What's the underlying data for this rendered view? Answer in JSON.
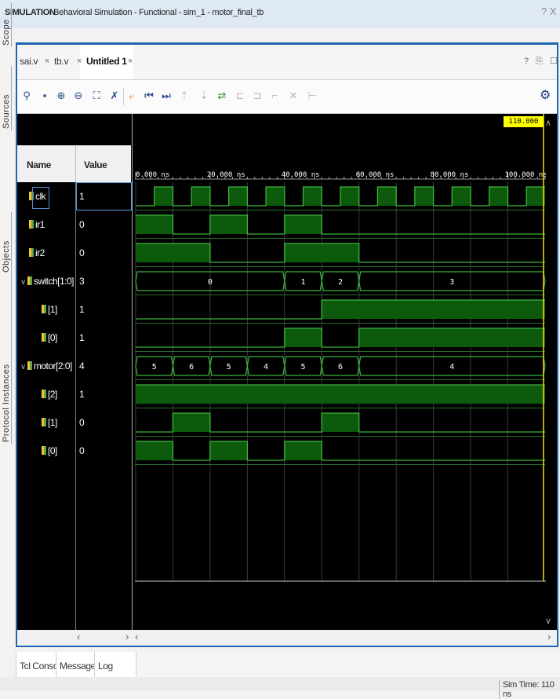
{
  "title": {
    "bold": "SIMULATION",
    "rest": " - Behavioral Simulation - Functional - sim_1 - motor_final_tb",
    "help": "? X"
  },
  "side_tabs": [
    "Scope",
    "Sources",
    "Objects",
    "Protocol Instances"
  ],
  "editor_tabs": [
    {
      "label": "sai.v",
      "close": "×"
    },
    {
      "label": "tb.v",
      "close": "×"
    },
    {
      "label": "Untitled 1",
      "close": "×"
    }
  ],
  "window_controls": "? ⎘ ☐",
  "toolbar_icons": [
    "search-icon",
    "save-icon",
    "zoom-in-icon",
    "zoom-out-icon",
    "zoom-fit-icon",
    "marker-icon",
    "cursor-icon",
    "go-first-icon",
    "go-last-icon",
    "add-marker-icon",
    "prev-marker-icon",
    "next-marker-icon",
    "swap-cursor-icon",
    "prev-transition-icon",
    "next-transition-icon",
    "delete-icon",
    "snap-icon",
    "settings-icon"
  ],
  "headers": {
    "name": "Name",
    "value": "Value"
  },
  "cursor_time": "110.000 ns",
  "time_axis": {
    "unit": "ns",
    "labels": [
      "0.000 ns",
      "20.000 ns",
      "40.000 ns",
      "60.000 ns",
      "80.000 ns",
      "100.000 ns"
    ],
    "label_times": [
      0,
      20,
      40,
      60,
      80,
      100
    ],
    "end": 110
  },
  "signals": [
    {
      "name": "clk",
      "value": "1",
      "type": "bit",
      "transitions": [
        [
          0,
          0
        ],
        [
          5,
          1
        ],
        [
          10,
          0
        ],
        [
          15,
          1
        ],
        [
          20,
          0
        ],
        [
          25,
          1
        ],
        [
          30,
          0
        ],
        [
          35,
          1
        ],
        [
          40,
          0
        ],
        [
          45,
          1
        ],
        [
          50,
          0
        ],
        [
          55,
          1
        ],
        [
          60,
          0
        ],
        [
          65,
          1
        ],
        [
          70,
          0
        ],
        [
          75,
          1
        ],
        [
          80,
          0
        ],
        [
          85,
          1
        ],
        [
          90,
          0
        ],
        [
          95,
          1
        ],
        [
          100,
          0
        ],
        [
          105,
          1
        ]
      ]
    },
    {
      "name": "ir1",
      "value": "0",
      "type": "bit",
      "transitions": [
        [
          0,
          1
        ],
        [
          10,
          0
        ],
        [
          20,
          1
        ],
        [
          30,
          0
        ],
        [
          40,
          1
        ],
        [
          50,
          0
        ]
      ]
    },
    {
      "name": "ir2",
      "value": "0",
      "type": "bit",
      "transitions": [
        [
          0,
          1
        ],
        [
          20,
          0
        ],
        [
          40,
          1
        ],
        [
          60,
          0
        ]
      ]
    },
    {
      "name": "switch[1:0]",
      "value": "3",
      "type": "bus",
      "expandable": true,
      "segments": [
        [
          0,
          40,
          "0"
        ],
        [
          40,
          50,
          "1"
        ],
        [
          50,
          60,
          "2"
        ],
        [
          60,
          110,
          "3"
        ]
      ]
    },
    {
      "name": "[1]",
      "value": "1",
      "type": "bit",
      "child": true,
      "transitions": [
        [
          0,
          0
        ],
        [
          50,
          1
        ]
      ]
    },
    {
      "name": "[0]",
      "value": "1",
      "type": "bit",
      "child": true,
      "transitions": [
        [
          0,
          0
        ],
        [
          40,
          1
        ],
        [
          50,
          0
        ],
        [
          60,
          1
        ]
      ]
    },
    {
      "name": "motor[2:0]",
      "value": "4",
      "type": "bus",
      "expandable": true,
      "segments": [
        [
          0,
          10,
          "5"
        ],
        [
          10,
          20,
          "6"
        ],
        [
          20,
          30,
          "5"
        ],
        [
          30,
          40,
          "4"
        ],
        [
          40,
          50,
          "5"
        ],
        [
          50,
          60,
          "6"
        ],
        [
          60,
          110,
          "4"
        ]
      ]
    },
    {
      "name": "[2]",
      "value": "1",
      "type": "bit",
      "child": true,
      "transitions": [
        [
          0,
          1
        ]
      ]
    },
    {
      "name": "[1]",
      "value": "0",
      "type": "bit",
      "child": true,
      "transitions": [
        [
          0,
          0
        ],
        [
          10,
          1
        ],
        [
          20,
          0
        ],
        [
          50,
          1
        ],
        [
          60,
          0
        ]
      ]
    },
    {
      "name": "[0]",
      "value": "0",
      "type": "bit",
      "child": true,
      "transitions": [
        [
          0,
          1
        ],
        [
          10,
          0
        ],
        [
          20,
          1
        ],
        [
          30,
          0
        ],
        [
          40,
          1
        ],
        [
          50,
          0
        ]
      ]
    }
  ],
  "bottom_tabs": [
    "Tcl Console",
    "Messages",
    "Log"
  ],
  "status": {
    "sim_time": "Sim Time: 110 ns"
  },
  "scroll": {
    "left": "‹",
    "right": "›"
  },
  "colors": {
    "wave": "#3cb43c",
    "fill": "#0d5a0d",
    "grid": "#3a3a3a",
    "cursor": "#f0e000",
    "background": "#000000"
  }
}
